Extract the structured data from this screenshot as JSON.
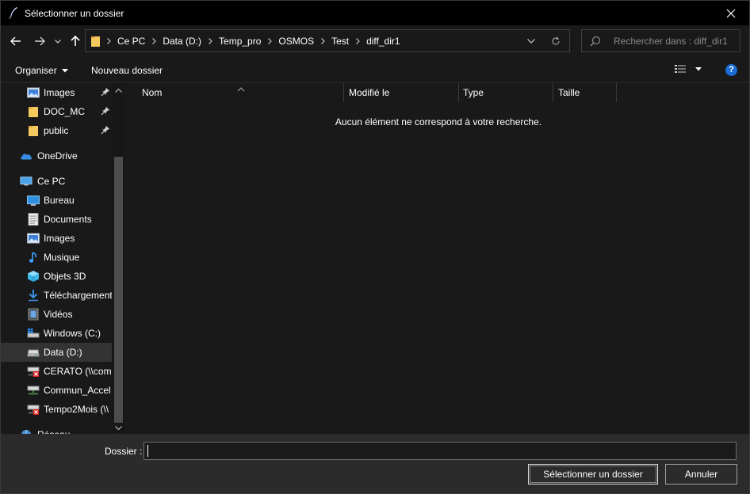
{
  "window": {
    "title": "Sélectionner un dossier",
    "close_icon": "close-icon"
  },
  "nav": {
    "back_icon": "arrow-left-icon",
    "forward_icon": "arrow-right-icon",
    "recent_icon": "chevron-down-icon",
    "up_icon": "arrow-up-icon",
    "breadcrumbs": [
      "Ce PC",
      "Data (D:)",
      "Temp_pro",
      "OSMOS",
      "Test",
      "diff_dir1"
    ],
    "search_placeholder": "Rechercher dans : diff_dir1"
  },
  "toolbar": {
    "organize_label": "Organiser",
    "new_folder_label": "Nouveau dossier",
    "help_label": "?"
  },
  "sidebar": {
    "items": [
      {
        "label": "Images",
        "icon": "pictures-icon",
        "pinned": true,
        "level": 2
      },
      {
        "label": "DOC_MC",
        "icon": "folder-icon",
        "pinned": true,
        "level": 2
      },
      {
        "label": "public",
        "icon": "folder-icon",
        "pinned": true,
        "level": 2
      },
      {
        "label": "OneDrive",
        "icon": "onedrive-icon",
        "pinned": false,
        "level": 1
      },
      {
        "label": "Ce PC",
        "icon": "computer-icon",
        "pinned": false,
        "level": 1
      },
      {
        "label": "Bureau",
        "icon": "desktop-icon",
        "pinned": false,
        "level": 2
      },
      {
        "label": "Documents",
        "icon": "documents-icon",
        "pinned": false,
        "level": 2
      },
      {
        "label": "Images",
        "icon": "pictures-icon",
        "pinned": false,
        "level": 2
      },
      {
        "label": "Musique",
        "icon": "music-icon",
        "pinned": false,
        "level": 2
      },
      {
        "label": "Objets 3D",
        "icon": "objects-3d-icon",
        "pinned": false,
        "level": 2
      },
      {
        "label": "Téléchargements",
        "icon": "downloads-icon",
        "pinned": false,
        "level": 2
      },
      {
        "label": "Vidéos",
        "icon": "videos-icon",
        "pinned": false,
        "level": 2
      },
      {
        "label": "Windows (C:)",
        "icon": "windows-drive-icon",
        "pinned": false,
        "level": 2
      },
      {
        "label": "Data (D:)",
        "icon": "drive-icon",
        "pinned": false,
        "level": 2,
        "selected": true
      },
      {
        "label": "CERATO (\\\\comr",
        "icon": "network-drive-disconnected-icon",
        "pinned": false,
        "level": 2
      },
      {
        "label": "Commun_Accel",
        "icon": "network-drive-icon",
        "pinned": false,
        "level": 2
      },
      {
        "label": "Tempo2Mois (\\\\",
        "icon": "network-drive-disconnected-icon",
        "pinned": false,
        "level": 2
      },
      {
        "label": "Réseau",
        "icon": "network-icon",
        "pinned": false,
        "level": 1
      }
    ]
  },
  "content": {
    "columns": [
      "Nom",
      "Modifié le",
      "Type",
      "Taille"
    ],
    "empty_message": "Aucun élément ne correspond à votre recherche."
  },
  "footer": {
    "folder_label": "Dossier :",
    "folder_value": "",
    "select_button": "Sélectionner un dossier",
    "cancel_button": "Annuler"
  },
  "colors": {
    "background": "#191919",
    "titlebar": "#000000",
    "footer": "#2b2b2b",
    "accent": "#1a6bd3",
    "folder": "#f4c95d"
  }
}
